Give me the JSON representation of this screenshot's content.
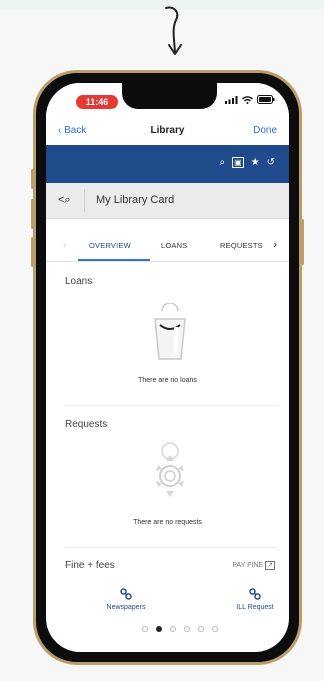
{
  "status": {
    "time": "11:46"
  },
  "nav": {
    "back_label": "Back",
    "title": "Library",
    "done_label": "Done"
  },
  "toolbar": {
    "icons": [
      "search-icon",
      "card-icon",
      "star-icon",
      "history-icon"
    ],
    "search_glyph": "⌕",
    "card_glyph": "▣",
    "star_glyph": "★",
    "history_glyph": "↺"
  },
  "card": {
    "back_label": "<⌕",
    "title": "My Library Card"
  },
  "tabs": {
    "prev": "‹",
    "next": "›",
    "items": [
      "OVERVIEW",
      "LOANS",
      "REQUESTS"
    ],
    "active": "OVERVIEW"
  },
  "sections": {
    "loans": {
      "title": "Loans",
      "empty_text": "There are no loans"
    },
    "requests": {
      "title": "Requests",
      "empty_text": "There are no requests"
    },
    "fines": {
      "title": "Fine + fees",
      "action_label": "PAY FINE",
      "action_icon": "↗"
    }
  },
  "bottom_links": [
    {
      "label": "Newspapers",
      "icon": "link-icon"
    },
    {
      "label": "ILL Request",
      "icon": "link-icon"
    }
  ],
  "pager": {
    "count": 6,
    "active_index": 1
  },
  "colors": {
    "header_blue": "#1f4a8c",
    "link_blue": "#2f6fde",
    "time_red": "#e53935",
    "frame_gold": "#b9a06a"
  }
}
